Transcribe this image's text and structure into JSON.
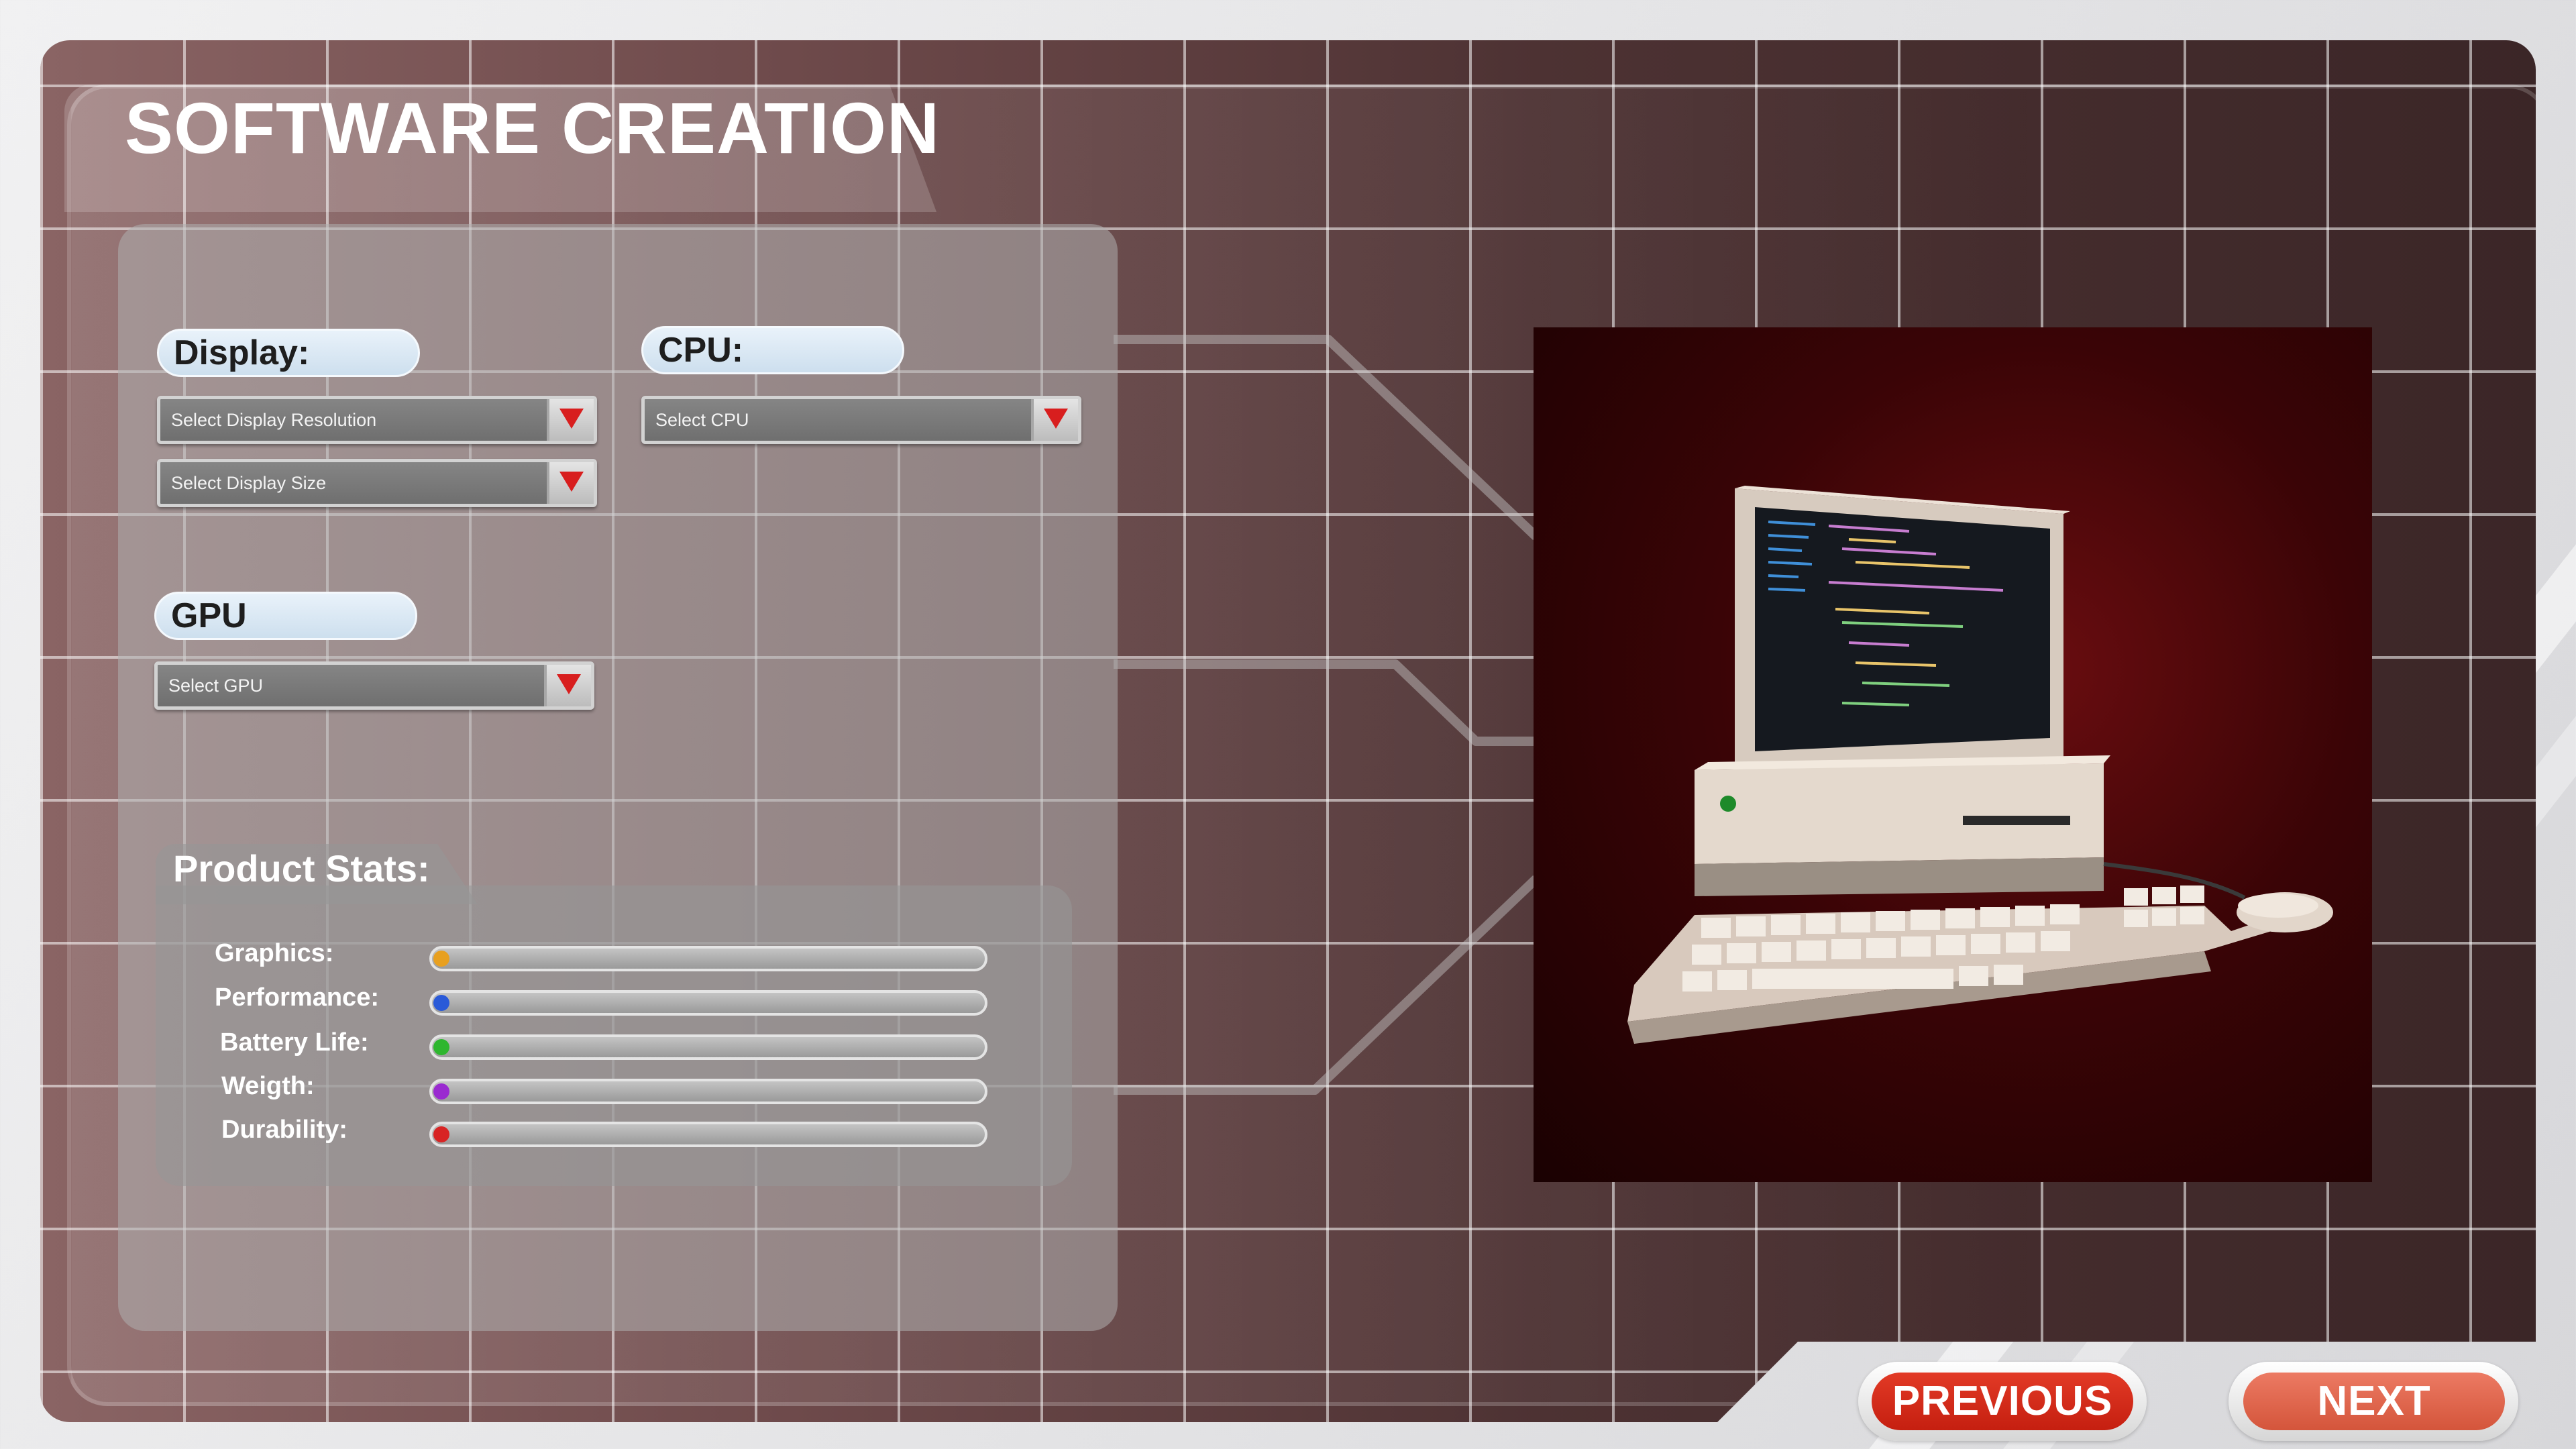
{
  "title": "SOFTWARE CREATION",
  "display": {
    "label": "Display:",
    "resolution_placeholder": "Select Display Resolution",
    "size_placeholder": "Select Display Size"
  },
  "cpu": {
    "label": "CPU:",
    "placeholder": "Select CPU"
  },
  "gpu": {
    "label": "GPU",
    "placeholder": "Select GPU"
  },
  "stats": {
    "title": "Product Stats:",
    "items": [
      {
        "label": "Graphics:",
        "color": "#e8a020",
        "value": 0.02
      },
      {
        "label": "Performance:",
        "color": "#2a5ad8",
        "value": 0.02
      },
      {
        "label": "Battery Life:",
        "color": "#2eb62e",
        "value": 0.02
      },
      {
        "label": "Weigth:",
        "color": "#9a2ad0",
        "value": 0.02
      },
      {
        "label": "Durability:",
        "color": "#d82424",
        "value": 0.02
      }
    ]
  },
  "preview": {
    "icon": "retro-computer-image"
  },
  "nav": {
    "previous_label": "PREVIOUS",
    "next_label": "NEXT"
  }
}
